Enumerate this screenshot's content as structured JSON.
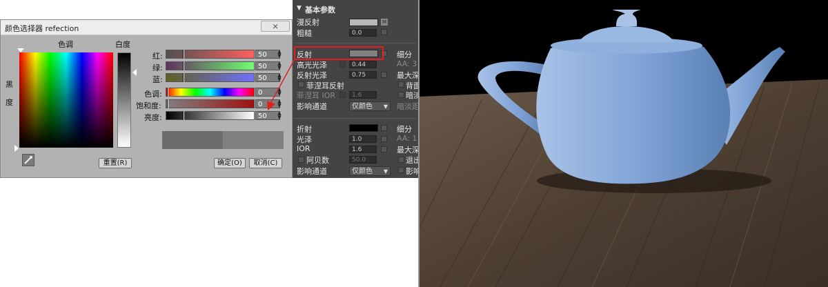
{
  "dialog": {
    "title": "颜色选择器 refection",
    "close_label": "⨯",
    "hue_label": "色调",
    "whiteness_label": "白度",
    "blackness_label_top": "黑",
    "blackness_label_bottom": "度",
    "channels": [
      {
        "label": "红:",
        "value": "50"
      },
      {
        "label": "绿:",
        "value": "50"
      },
      {
        "label": "蓝:",
        "value": "50"
      },
      {
        "label": "色调:",
        "value": "0"
      },
      {
        "label": "饱和度:",
        "value": "0"
      },
      {
        "label": "亮度:",
        "value": "50"
      }
    ],
    "reset_label": "重置(R)",
    "ok_label": "确定(O)",
    "cancel_label": "取消(C)"
  },
  "panel": {
    "section_title": "基本参数",
    "diffuse": {
      "label": "漫反射",
      "map_label": "M"
    },
    "roughness": {
      "label": "粗糙",
      "value": "0.0"
    },
    "reflect": {
      "label": "反射",
      "subdivs_label": "细分"
    },
    "hilight_gloss": {
      "label": "高光光泽",
      "value": "0.44",
      "right": "AA: 3"
    },
    "refl_gloss": {
      "label": "反射光泽",
      "value": "0.75",
      "right": "最大深"
    },
    "fresnel": {
      "label": "菲涅耳反射",
      "right": "背面"
    },
    "fresnel_ior": {
      "label": "菲涅耳 IOR",
      "value": "1.6",
      "right": "暗淡"
    },
    "exit_color": {
      "label": "影响通道",
      "option": "仅颜色",
      "right": "暗淡距"
    },
    "refract": {
      "label": "折射",
      "subdivs_label": "细分"
    },
    "glossiness": {
      "label": "光泽",
      "value": "1.0",
      "right": "AA: 1"
    },
    "ior": {
      "label": "IOR",
      "value": "1.6",
      "right": "最大深"
    },
    "abbe": {
      "label": "阿贝数",
      "value": "50.0",
      "right": "退出"
    },
    "refr_channels": {
      "label": "影响通道",
      "option": "仅颜色",
      "right": "影响"
    }
  },
  "colors": {
    "dialog_bg": "#b2b2b2",
    "panel_bg": "#444444",
    "highlight_red": "#e02020",
    "teapot_blue": "#7fa3d6",
    "table_wood": "#5b4a3c",
    "reflect_swatch": "#808080",
    "refract_swatch": "#000000"
  },
  "icons": {
    "eyedropper": "eyedropper-icon",
    "close": "close-icon"
  }
}
